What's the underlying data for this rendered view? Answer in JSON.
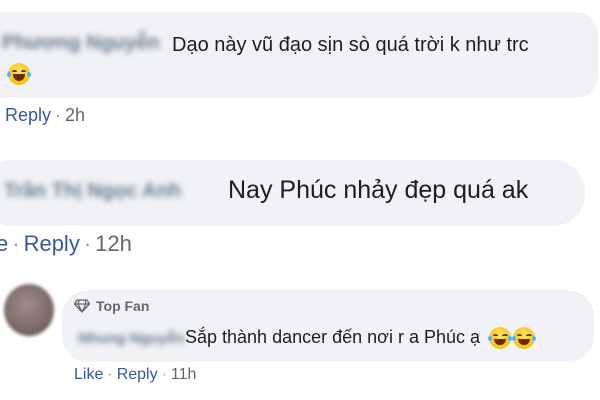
{
  "comments": [
    {
      "author": "Phương Nguyễn",
      "text": "Dạo này vũ đạo sịn sò quá trời k như trc",
      "reply_label": "Reply",
      "time": "2h",
      "emoji": "laughing-tears-emoji"
    },
    {
      "author": "Trần Thị Ngọc Anh",
      "text": "Nay Phúc nhảy đẹp quá ak",
      "reply_label": "Reply",
      "time": "12h",
      "leading_fragment": "e"
    },
    {
      "badge": "Top Fan",
      "badge_icon": "diamond-icon",
      "author": "Nhung Nguyễn",
      "text": "Sắp thành dancer đến nơi r a Phúc ạ",
      "like_label": "Like",
      "reply_label": "Reply",
      "time": "11h",
      "emoji": "laughing-tears-emoji"
    }
  ],
  "colors": {
    "bubble": "#f0f2f5",
    "link": "#385898",
    "text": "#1c1e21",
    "meta": "#606770"
  }
}
